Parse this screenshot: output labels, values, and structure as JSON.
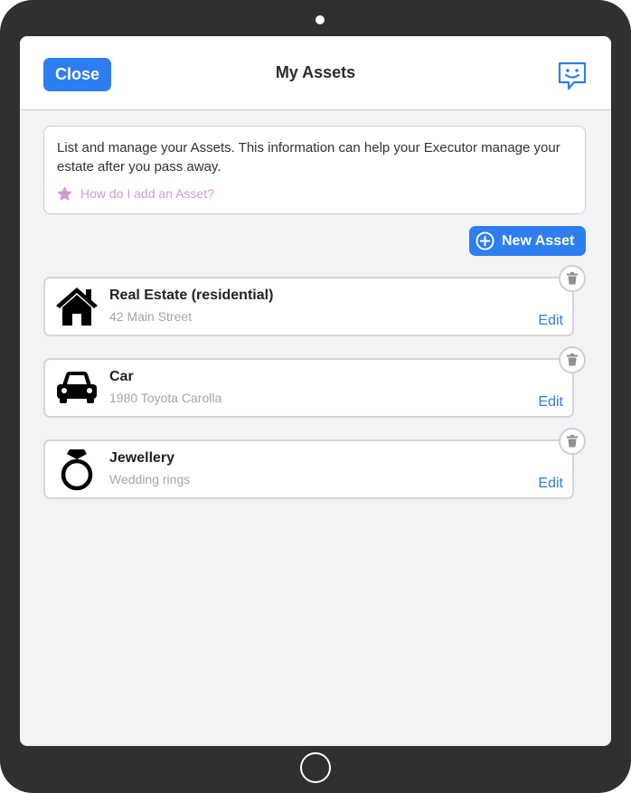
{
  "header": {
    "close_label": "Close",
    "title": "My Assets",
    "feedback_icon": "chat-smile-icon"
  },
  "info": {
    "text": "List and manage your Assets. This information can help your Executor manage your estate after you pass away.",
    "help_link": "How do I add an Asset?",
    "help_icon": "star-icon"
  },
  "new_asset_label": "New Asset",
  "assets": [
    {
      "title": "Real Estate (residential)",
      "subtitle": "42 Main Street",
      "edit_label": "Edit",
      "icon": "house-icon"
    },
    {
      "title": "Car",
      "subtitle": "1980 Toyota Carolla",
      "edit_label": "Edit",
      "icon": "car-icon"
    },
    {
      "title": "Jewellery",
      "subtitle": "Wedding rings",
      "edit_label": "Edit",
      "icon": "ring-icon"
    }
  ],
  "colors": {
    "accent": "#2d7ef0",
    "link_pink": "#d39ad8",
    "device_frame": "#303030",
    "screen_bg": "#f3f3f6"
  }
}
